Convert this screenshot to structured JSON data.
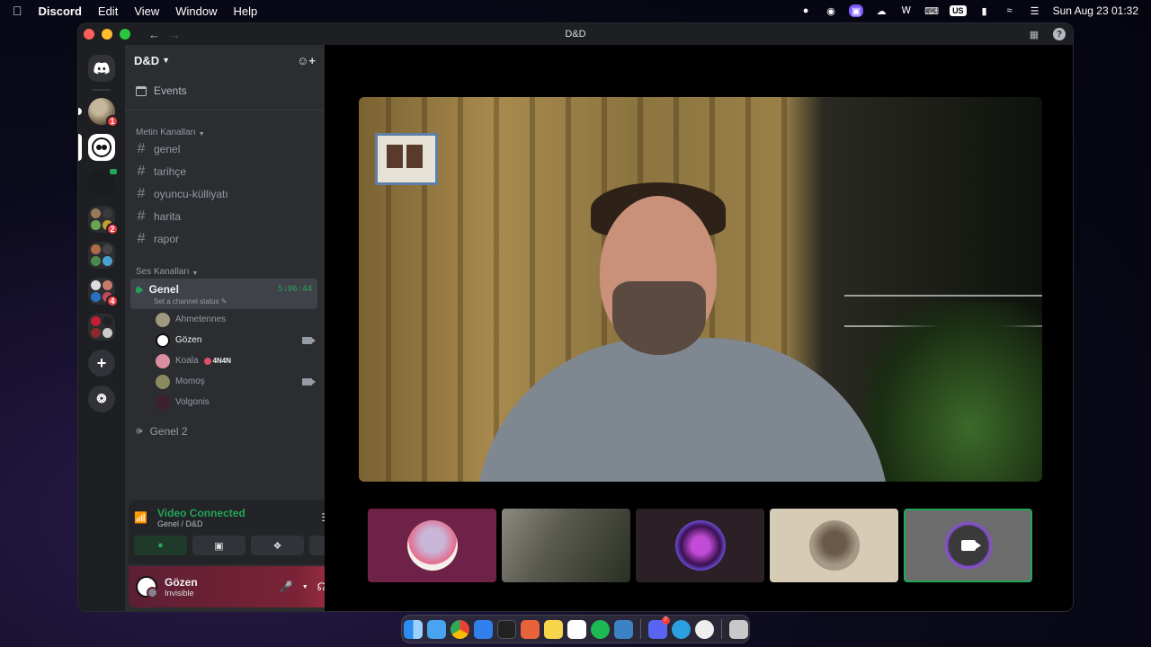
{
  "menubar": {
    "apple_icon": "apple-icon",
    "app_name": "Discord",
    "menus": [
      "Edit",
      "View",
      "Window",
      "Help"
    ],
    "input_source": "US",
    "datetime": "Sun Aug 23  01:32"
  },
  "window": {
    "title": "D&D"
  },
  "rail": {
    "badges": {
      "server1": "1",
      "folder1": "2",
      "folder3": "4"
    }
  },
  "guild": {
    "name": "D&D",
    "events_label": "Events",
    "text_category": "Metin Kanalları",
    "text_channels": [
      "genel",
      "tarihçe",
      "oyuncu-külliyatı",
      "harita",
      "rapor"
    ],
    "voice_category": "Ses Kanalları",
    "active_voice": {
      "name": "Genel",
      "timer": "5:06:44",
      "status_placeholder": "Set a channel status",
      "users": [
        {
          "name": "Ahmetennes",
          "color": "#a09880"
        },
        {
          "name": "Gözen",
          "color": "#ffffff"
        },
        {
          "name": "Koala",
          "color": "#d98fa0",
          "tag": "4N4N"
        },
        {
          "name": "Momoş",
          "color": "#8a8a60"
        },
        {
          "name": "Volgonis",
          "color": "#402030"
        }
      ]
    },
    "voice2": "Genel 2"
  },
  "rtc": {
    "status": "Video Connected",
    "location": "Genel / D&D"
  },
  "user": {
    "name": "Gözen",
    "status": "Invisible"
  },
  "colors": {
    "accent_green": "#23a559",
    "danger_red": "#f23f43",
    "blurple": "#5865f2"
  },
  "dock": {
    "discord_badge": "7"
  }
}
